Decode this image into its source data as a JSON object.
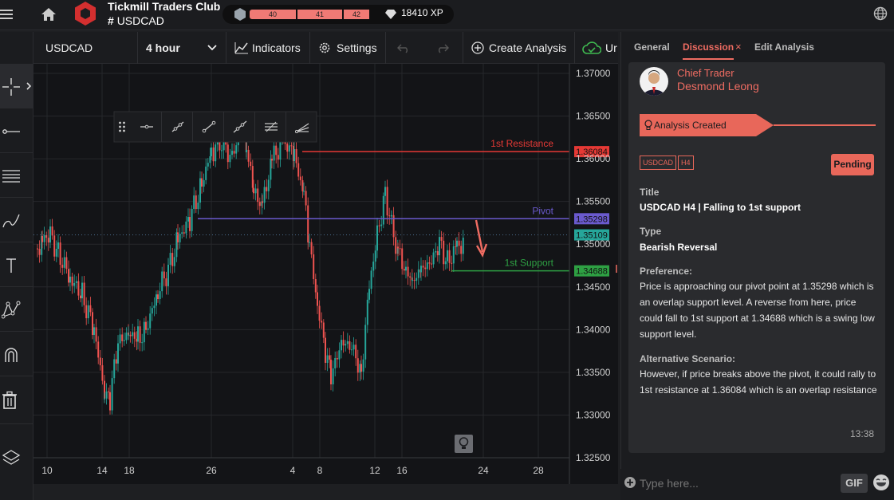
{
  "header": {
    "club_name": "Tickmill Traders Club",
    "club_tag": "USDCAD",
    "levels": [
      "40",
      "41",
      "42"
    ],
    "xp": "18410 XP"
  },
  "toolbar": {
    "symbol": "USDCAD",
    "interval": "4 hour",
    "indicators": "Indicators",
    "settings": "Settings",
    "create_analysis": "Create Analysis",
    "truncated": "Ur"
  },
  "chart_data": {
    "type": "candlestick",
    "y_ticks": [
      "1.37000",
      "1.36500",
      "1.36000",
      "1.35500",
      "1.35000",
      "1.34500",
      "1.34000",
      "1.33500",
      "1.33000",
      "1.32500"
    ],
    "ylim": [
      1.325,
      1.37
    ],
    "x_ticks": [
      "10",
      "14",
      "18",
      "26",
      "4",
      "8",
      "12",
      "16",
      "24",
      "28"
    ],
    "lines": [
      {
        "name": "1st Resistance",
        "value": "1.36084",
        "color": "#e53935"
      },
      {
        "name": "Pivot",
        "value": "1.35298",
        "color": "#6a5acd"
      },
      {
        "name": "1st Support",
        "value": "1.34688",
        "color": "#2ea043"
      }
    ],
    "current_price": "1.35109"
  },
  "panel": {
    "tabs": [
      "General",
      "Discussion",
      "Edit Analysis"
    ],
    "author_role": "Chief Trader",
    "author_name": "Desmond Leong",
    "status_banner": "Analysis Created",
    "symbol_tag": "USDCAD",
    "tf_tag": "H4",
    "status_badge": "Pending",
    "title_label": "Title",
    "title": "USDCAD H4 | Falling to 1st support",
    "type_label": "Type",
    "type": "Bearish Reversal",
    "preference_label": "Preference:",
    "preference": "Price is approaching our pivot point at 1.35298 which is an overlap support level. A reverse from here, price could fall to 1st support at 1.34688 which is a swing low support level.",
    "alt_label": "Alternative Scenario:",
    "alt": "However, if price breaks above the pivot, it could rally to 1st resistance at 1.36084  which is an overlap resistance",
    "time": "13:38",
    "input_placeholder": "Type here...",
    "gif": "GIF"
  },
  "colors": {
    "accent": "#e8675a",
    "up": "#26a69a",
    "down": "#ef5350"
  }
}
